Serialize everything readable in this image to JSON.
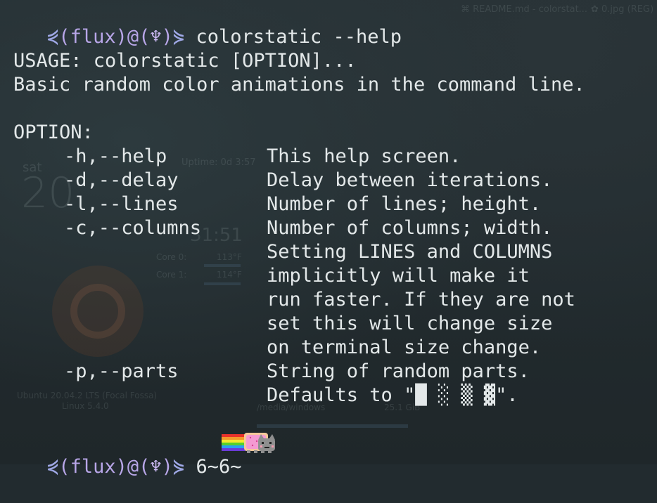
{
  "window": {
    "tabs": [
      {
        "label": "README.md - colorstat..."
      },
      {
        "label": "0.jpg (REG)"
      }
    ]
  },
  "desktop_widgets": {
    "uptime": "Uptime: 0d 3:57",
    "day": "sat",
    "date": "20",
    "time": "31:51",
    "core0_label": "Core 0:",
    "core0_temp": "113°F",
    "core1_label": "Core 1:",
    "core1_temp": "114°F",
    "os": "Ubuntu 20.04.2 LTS (Focal Fossa)",
    "kernel": "Linux 5.4.0",
    "disk_path": "/media/windows",
    "disk_size": "25.1 GiB"
  },
  "terminal": {
    "prompt": {
      "left_arrow": "⋞",
      "open_paren": "(",
      "user": "flux",
      "close_paren": ")",
      "at": "@",
      "host_open": "(",
      "host": "♆",
      "host_close": ")",
      "right_arrow": "⋟"
    },
    "command": "colorstatic --help",
    "usage": "USAGE: colorstatic [OPTION]...",
    "description": "Basic random color animations in the command line.",
    "options_header": "OPTION:",
    "options": [
      {
        "flag": "-h,--help",
        "desc": [
          "This help screen."
        ]
      },
      {
        "flag": "-d,--delay",
        "desc": [
          "Delay between iterations."
        ]
      },
      {
        "flag": "-l,--lines",
        "desc": [
          "Number of lines; height."
        ]
      },
      {
        "flag": "-c,--columns",
        "desc": [
          "Number of columns; width.",
          "Setting LINES and COLUMNS",
          "implicitly will make it",
          "run faster. If they are not",
          "set this will change size",
          "on terminal size change."
        ]
      },
      {
        "flag": "-p,--parts",
        "desc": [
          "String of random parts.",
          "Defaults to \"█ ░ ▒ ▓\"."
        ]
      }
    ],
    "second_prompt_suffix": "6~6~"
  }
}
